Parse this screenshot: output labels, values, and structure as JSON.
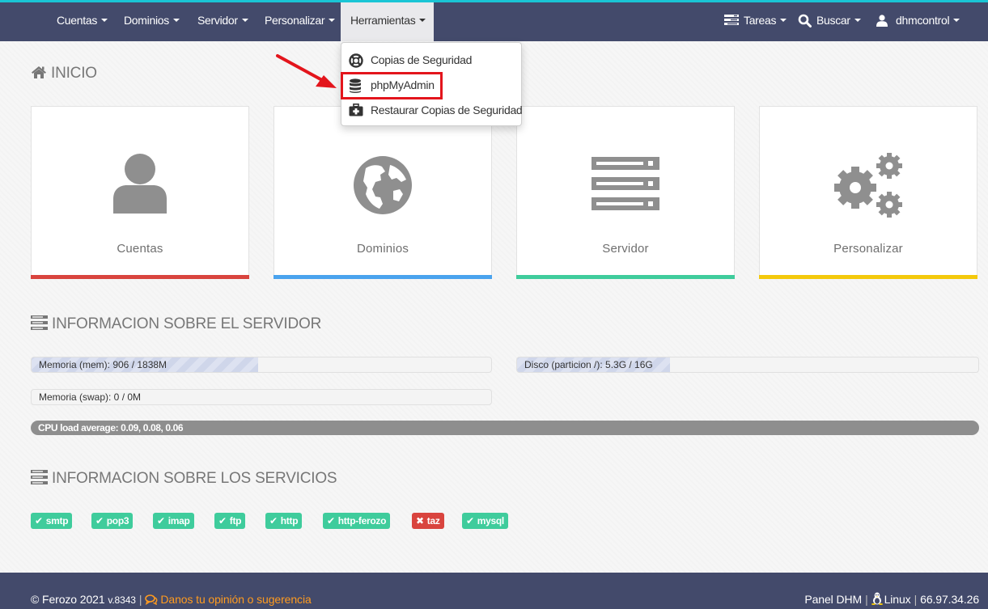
{
  "nav": {
    "left_items": [
      {
        "label": "Cuentas"
      },
      {
        "label": "Dominios"
      },
      {
        "label": "Servidor"
      },
      {
        "label": "Personalizar"
      },
      {
        "label": "Herramientas"
      }
    ],
    "right_items": [
      {
        "label": "Tareas",
        "icon": "tasks-icon"
      },
      {
        "label": "Buscar",
        "icon": "search-icon"
      },
      {
        "label": "dhmcontrol",
        "icon": "user-icon"
      }
    ]
  },
  "dropdown": {
    "items": [
      {
        "label": "Copias de Seguridad",
        "icon": "lifebuoy-icon"
      },
      {
        "label": "phpMyAdmin",
        "icon": "database-icon"
      },
      {
        "label": "Restaurar Copias de Seguridad",
        "icon": "medkit-icon"
      }
    ]
  },
  "home": {
    "title": "INICIO",
    "cards": [
      {
        "label": "Cuentas",
        "icon": "user-icon",
        "color": "#d9443e"
      },
      {
        "label": "Dominios",
        "icon": "globe-icon",
        "color": "#4aa3ee"
      },
      {
        "label": "Servidor",
        "icon": "server-icon",
        "color": "#3fcc9c"
      },
      {
        "label": "Personalizar",
        "icon": "gears-icon",
        "color": "#f4c90c"
      }
    ]
  },
  "server_info": {
    "title": "INFORMACION SOBRE EL SERVIDOR",
    "memory": {
      "label": "Memoria (mem): 906 / 1838M",
      "used_fraction": 0.493
    },
    "disk": {
      "label": "Disco (particion /): 5.3G / 16G",
      "used_fraction": 0.331
    },
    "swap": {
      "label": "Memoria (swap): 0 / 0M",
      "used_fraction": 0
    },
    "cpu": {
      "label": "CPU load average: 0.09, 0.08, 0.06"
    }
  },
  "services": {
    "title": "INFORMACION SOBRE LOS SERVICIOS",
    "items": [
      {
        "label": "smtp",
        "status": "ok"
      },
      {
        "label": "pop3",
        "status": "ok"
      },
      {
        "label": "imap",
        "status": "ok"
      },
      {
        "label": "ftp",
        "status": "ok"
      },
      {
        "label": "http",
        "status": "ok"
      },
      {
        "label": "http-ferozo",
        "status": "ok"
      },
      {
        "label": "taz",
        "status": "error"
      },
      {
        "label": "mysql",
        "status": "ok"
      }
    ],
    "colors": {
      "ok": "#3fcc9c",
      "error": "#d9443e"
    }
  },
  "footer": {
    "copyright": "© Ferozo 2021",
    "version": "v.8343",
    "feedback": "Danos tu opinión o sugerencia",
    "panel": "Panel DHM",
    "os": "Linux",
    "ip": "66.97.34.26"
  },
  "colors": {
    "navbar": "#434a6b",
    "accent_top": "#19c5d5",
    "highlight": "#e3151c",
    "feedback": "#ff9b1f"
  }
}
